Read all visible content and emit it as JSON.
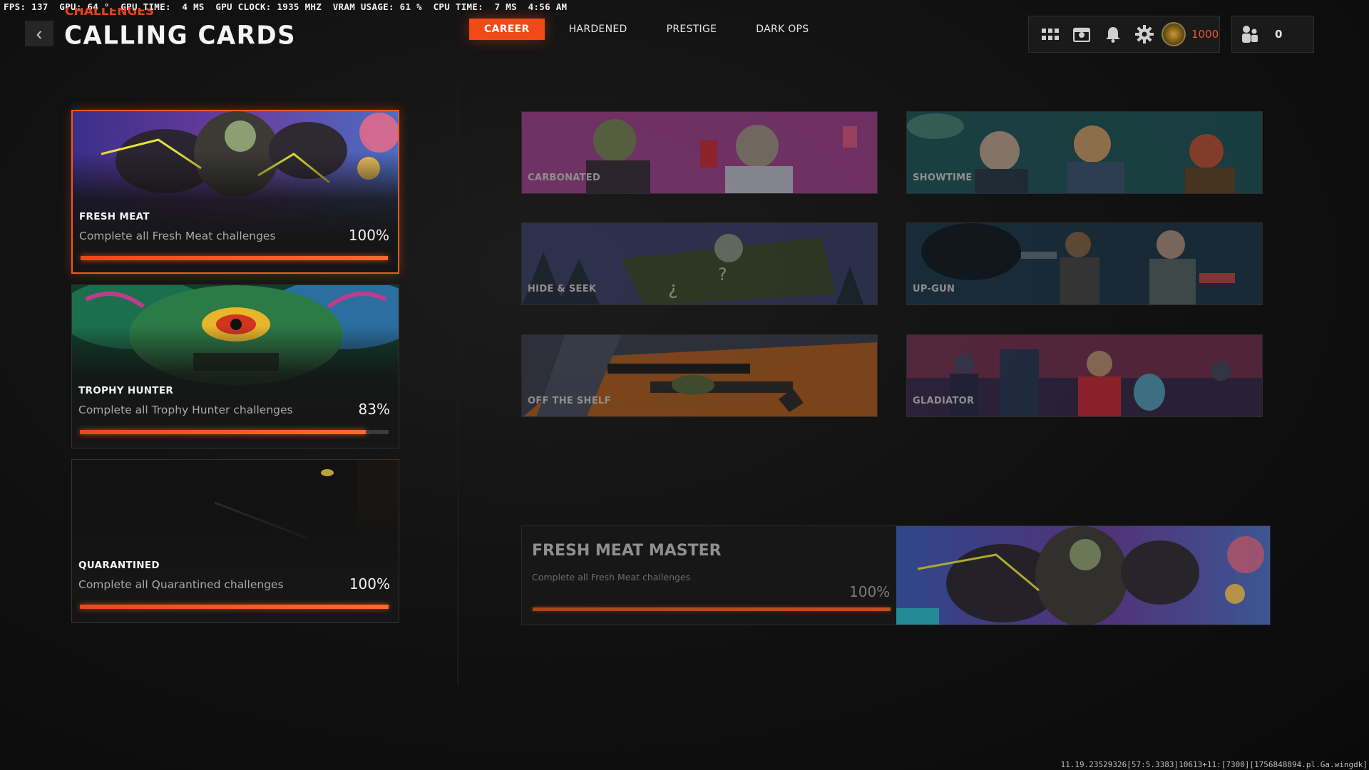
{
  "perf_overlay": "FPS: 137  GPU: 64 °  GPU TIME:  4 MS  GPU CLOCK: 1935 MHZ  VRAM USAGE: 61 %  CPU TIME:  7 MS  4:56 AM",
  "header": {
    "breadcrumb": "CHALLENGES",
    "title": "CALLING CARDS",
    "back_icon": "chevron-left-icon"
  },
  "tabs": [
    {
      "label": "CAREER",
      "active": true
    },
    {
      "label": "HARDENED",
      "active": false
    },
    {
      "label": "PRESTIGE",
      "active": false
    },
    {
      "label": "DARK OPS",
      "active": false
    }
  ],
  "hud": {
    "cp_value": "1000",
    "social_count": "0",
    "icons": [
      "grid-menu-icon",
      "store-icon",
      "notification-bell-icon",
      "settings-gear-icon",
      "cod-points-icon",
      "social-icon"
    ],
    "accent": "#f04a18"
  },
  "categories": [
    {
      "name": "FRESH MEAT",
      "description": "Complete all Fresh Meat challenges",
      "percent": "100%",
      "progress": 1.0,
      "selected": true
    },
    {
      "name": "TROPHY HUNTER",
      "description": "Complete all Trophy Hunter challenges",
      "percent": "83%",
      "progress": 0.925,
      "selected": false
    },
    {
      "name": "QUARANTINED",
      "description": "Complete all Quarantined challenges",
      "percent": "100%",
      "progress": 1.0,
      "selected": false
    }
  ],
  "cards": [
    {
      "label": "CARBONATED"
    },
    {
      "label": "SHOWTIME"
    },
    {
      "label": "HIDE & SEEK"
    },
    {
      "label": "UP-GUN"
    },
    {
      "label": "OFF THE SHELF"
    },
    {
      "label": "GLADIATOR"
    }
  ],
  "master": {
    "title": "FRESH MEAT MASTER",
    "description": "Complete all Fresh Meat challenges",
    "percent": "100%",
    "progress": 1.0
  },
  "build_string": "11.19.23529326[57:5.3383]10613+11:[7300][1756848894.pl.Ga.wingdk]"
}
